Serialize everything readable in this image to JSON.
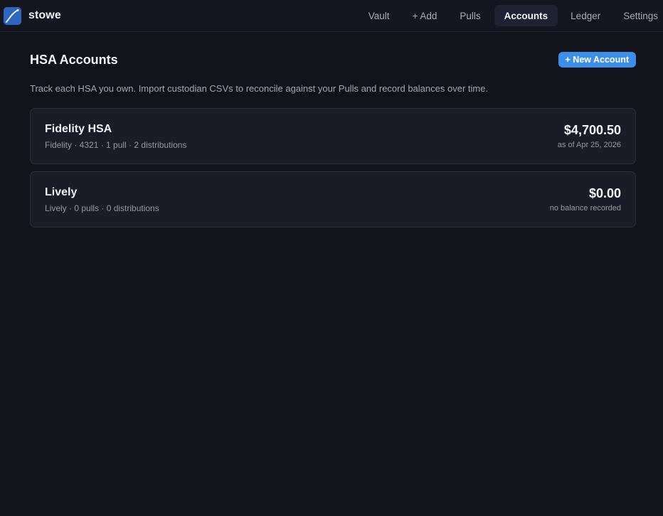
{
  "app": {
    "name": "stowe",
    "logo_icon": "curve-line-icon"
  },
  "nav": {
    "items": [
      {
        "label": "Vault",
        "active": false
      },
      {
        "label": "+ Add",
        "active": false
      },
      {
        "label": "Pulls",
        "active": false
      },
      {
        "label": "Accounts",
        "active": true
      },
      {
        "label": "Ledger",
        "active": false
      },
      {
        "label": "Settings",
        "active": false
      }
    ]
  },
  "page": {
    "title": "HSA Accounts",
    "new_button_label": "+ New Account",
    "description": "Track each HSA you own. Import custodian CSVs to reconcile against your Pulls and record balances over time."
  },
  "accounts": [
    {
      "name": "Fidelity HSA",
      "meta": "Fidelity · 4321 · 1 pull · 2 distributions",
      "balance": "$4,700.50",
      "as_of": "as of Apr 25, 2026"
    },
    {
      "name": "Lively",
      "meta": "Lively · 0 pulls · 0 distributions",
      "balance": "$0.00",
      "as_of": "no balance recorded"
    }
  ],
  "colors": {
    "background": "#11121a",
    "accent": "#3d8ee6",
    "card": "#1a1c27"
  }
}
